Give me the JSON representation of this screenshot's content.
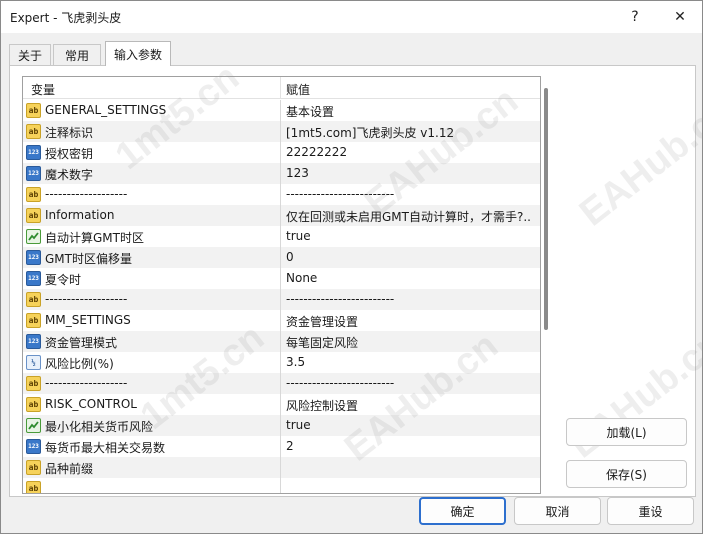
{
  "window": {
    "title": "Expert - 飞虎剥头皮",
    "help_glyph": "?",
    "close_glyph": "✕"
  },
  "tabs": [
    {
      "label": "关于",
      "active": false
    },
    {
      "label": "常用",
      "active": false
    },
    {
      "label": "输入参数",
      "active": true
    }
  ],
  "grid": {
    "col_variable": "变量",
    "col_value": "赋值",
    "rows": [
      {
        "icon": "ab",
        "name": "GENERAL_SETTINGS",
        "value": "基本设置"
      },
      {
        "icon": "ab",
        "name": "注释标识",
        "value": "[1mt5.com]飞虎剥头皮 v1.12"
      },
      {
        "icon": "123",
        "name": "授权密钥",
        "value": "22222222"
      },
      {
        "icon": "123",
        "name": "魔术数字",
        "value": "123"
      },
      {
        "icon": "ab",
        "name": "-------------------",
        "value": "-------------------------"
      },
      {
        "icon": "ab",
        "name": "Information",
        "value": "仅在回测或未启用GMT自动计算时，才需手?.."
      },
      {
        "icon": "bool",
        "name": "自动计算GMT时区",
        "value": "true"
      },
      {
        "icon": "123",
        "name": "GMT时区偏移量",
        "value": "0"
      },
      {
        "icon": "123",
        "name": "夏令时",
        "value": "None"
      },
      {
        "icon": "ab",
        "name": "-------------------",
        "value": "-------------------------"
      },
      {
        "icon": "ab",
        "name": "MM_SETTINGS",
        "value": "资金管理设置"
      },
      {
        "icon": "123",
        "name": "资金管理模式",
        "value": "每笔固定风险"
      },
      {
        "icon": "frac",
        "name": "风险比例(%)",
        "value": "3.5"
      },
      {
        "icon": "ab",
        "name": "-------------------",
        "value": "-------------------------"
      },
      {
        "icon": "ab",
        "name": "RISK_CONTROL",
        "value": "风险控制设置"
      },
      {
        "icon": "bool",
        "name": "最小化相关货币风险",
        "value": "true"
      },
      {
        "icon": "123",
        "name": "每货币最大相关交易数",
        "value": "2"
      },
      {
        "icon": "ab",
        "name": "品种前缀",
        "value": ""
      },
      {
        "icon": "ab",
        "name": "",
        "value": ""
      }
    ]
  },
  "watermarks": [
    "1mt5.cn",
    "EAHub.cn",
    "EAHub.cn",
    "1mt5.cn",
    "EAHub.cn",
    "EAHub.cn"
  ],
  "buttons": {
    "load": "加载(L)",
    "save": "保存(S)",
    "ok": "确定",
    "cancel": "取消",
    "reset": "重设"
  },
  "colors": {
    "accent": "#2d6fce",
    "alt_row": "#f2f2f2"
  }
}
